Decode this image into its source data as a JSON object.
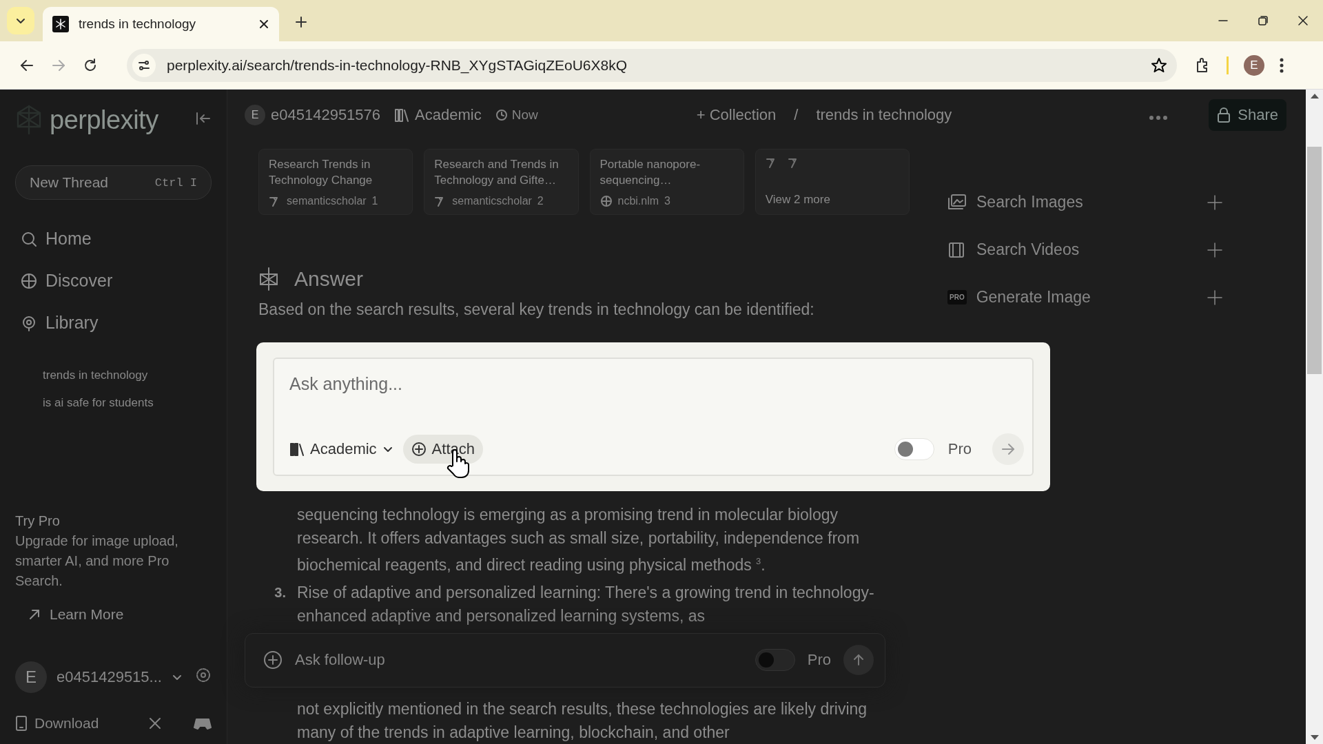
{
  "browser": {
    "tab_title": "trends in technology",
    "url": "perplexity.ai/search/trends-in-technology-RNB_XYgSTAGiqZEoU6X8kQ",
    "profile_initial": "E"
  },
  "sidebar": {
    "logo": "perplexity",
    "new_thread": {
      "label": "New Thread",
      "shortcut": "Ctrl I"
    },
    "nav": [
      {
        "label": "Home",
        "kind": "home"
      },
      {
        "label": "Discover",
        "kind": "discover"
      },
      {
        "label": "Library",
        "kind": "library"
      }
    ],
    "library_items": [
      "trends in technology",
      "is ai safe for students"
    ],
    "try_pro": {
      "title": "Try Pro",
      "text": "Upgrade for image upload, smarter AI, and more Pro Search."
    },
    "learn_more": "Learn More",
    "user": {
      "initial": "E",
      "name": "e0451429515..."
    },
    "download": "Download"
  },
  "header": {
    "user_initial": "E",
    "username": "e045142951576",
    "focus": "Academic",
    "time": "Now",
    "collection": "+ Collection",
    "separator": "/",
    "title": "trends in technology",
    "share": "Share"
  },
  "sources": [
    {
      "title": "Research Trends in Technology Change",
      "site": "semanticscholar",
      "index": "1",
      "kind": "semantic"
    },
    {
      "title": "Research and Trends in Technology and Gifte…",
      "site": "semanticscholar",
      "index": "2",
      "kind": "semantic"
    },
    {
      "title": "Portable nanopore-sequencing…",
      "site": "ncbi.nlm",
      "index": "3",
      "kind": "globe"
    }
  ],
  "more_sources": "View 2 more",
  "answer": {
    "heading": "Answer",
    "intro": "Based on the search results, several key trends in technology can be identified:",
    "blocks": [
      {
        "kind": "continuation",
        "text": "sequencing technology is emerging as a promising trend in molecular biology research. It offers advantages such as small size, portability, independence from biochemical reagents, and direct reading using physical methods $^{3}$."
      },
      {
        "kind": "numbered",
        "number": "3.",
        "text": "Rise of adaptive and personalized learning: There's a growing trend in technology-enhanced adaptive and personalized learning systems, as"
      },
      {
        "kind": "continuation",
        "text": "not explicitly mentioned in the search results, these technologies are likely driving many of the trends in adaptive learning, blockchain, and other"
      }
    ]
  },
  "follow_up": {
    "placeholder": "Ask follow-up",
    "pro_label": "Pro",
    "pro_on": false
  },
  "tools": [
    {
      "kind": "images",
      "label": "Search Images"
    },
    {
      "kind": "videos",
      "label": "Search Videos"
    },
    {
      "kind": "generate",
      "label": "Generate Image",
      "badge": "PRO"
    }
  ],
  "modal": {
    "placeholder": "Ask anything...",
    "focus": "Academic",
    "attach": "Attach",
    "pro_label": "Pro",
    "pro_on": false
  }
}
